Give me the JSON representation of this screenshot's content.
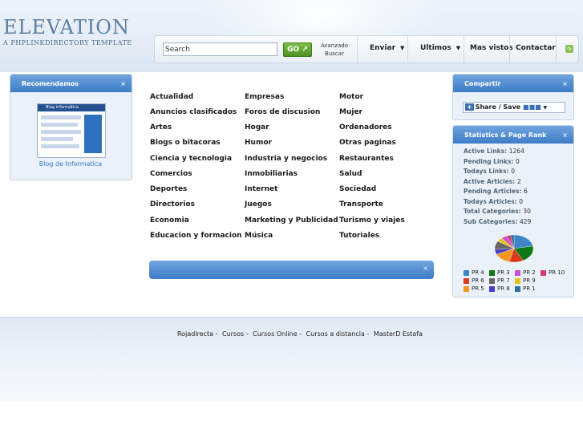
{
  "header": {
    "logo_text": "ELEVATION",
    "tagline": "A PHPLINKDIRECTORY TEMPLATE"
  },
  "search": {
    "value": "Search",
    "go_label": "GO",
    "advanced_line1": "Avanzado",
    "advanced_line2": "Buscar"
  },
  "nav": {
    "enviar": "Enviar",
    "ultimos": "Ultimos",
    "mas_vistos": "Mas vistos",
    "contactar": "Contactar",
    "rss_icon": "rss-icon"
  },
  "recomendamos": {
    "title": "Recomendamos",
    "close": "×",
    "thumb_title": "Blog informática",
    "caption": "Blog de Informatica"
  },
  "categories": {
    "col1": [
      "Actualidad",
      "Anuncios clasificados",
      "Artes",
      "Blogs o bitacoras",
      "Ciencia y tecnologia",
      "Comercios",
      "Deportes",
      "Directorios",
      "Economia",
      "Educacion y formacion"
    ],
    "col2": [
      "Empresas",
      "Foros de discusion",
      "Hogar",
      "Humor",
      "Industria y negocios",
      "Inmobiliarias",
      "Internet",
      "Juegos",
      "Marketing y Publicidad",
      "Música"
    ],
    "col3": [
      "Motor",
      "Mujer",
      "Ordenadores",
      "Otras paginas",
      "Restaurantes",
      "Salud",
      "Sociedad",
      "Transporte",
      "Turismo y viajes",
      "Tutoriales"
    ]
  },
  "center_bar": {
    "close": "×"
  },
  "compartir": {
    "title": "Compartir",
    "close": "×",
    "share_label": "Share / Save"
  },
  "stats": {
    "title": "Statistics & Page Rank",
    "close": "×",
    "rows": [
      {
        "label": "Active Links:",
        "value": "1264"
      },
      {
        "label": "Pending Links:",
        "value": "0"
      },
      {
        "label": "Todays Links:",
        "value": "0"
      },
      {
        "label": "Active Articles:",
        "value": "2"
      },
      {
        "label": "Pending Articles:",
        "value": "6"
      },
      {
        "label": "Todays Articles:",
        "value": "0"
      },
      {
        "label": "Total Categories:",
        "value": "30"
      },
      {
        "label": "Sub Categories:",
        "value": "429"
      }
    ],
    "pagerank_legend": [
      {
        "label": "PR 4",
        "color": "#3d85c6"
      },
      {
        "label": "PR 3",
        "color": "#0b7a14"
      },
      {
        "label": "PR 2",
        "color": "#c94fd0"
      },
      {
        "label": "PR 10",
        "color": "#d63a6a"
      },
      {
        "label": "PR 6",
        "color": "#d93b1c"
      },
      {
        "label": "PR 7",
        "color": "#666666"
      },
      {
        "label": "PR 9",
        "color": "#e0c21a"
      },
      {
        "label": "PR 5",
        "color": "#f2961e"
      },
      {
        "label": "PR 8",
        "color": "#4a3fc4"
      },
      {
        "label": "PR 1",
        "color": "#2e6fa8"
      }
    ],
    "pie_slices": [
      {
        "label": "PR 4",
        "value": 22,
        "color": "#3d85c6"
      },
      {
        "label": "PR 3",
        "value": 20,
        "color": "#0b7a14"
      },
      {
        "label": "PR 6",
        "value": 12,
        "color": "#d93b1c"
      },
      {
        "label": "PR 5",
        "value": 14,
        "color": "#f2961e"
      },
      {
        "label": "PR 8",
        "value": 6,
        "color": "#4a3fc4"
      },
      {
        "label": "PR 7",
        "value": 10,
        "color": "#666666"
      },
      {
        "label": "PR 9",
        "value": 5,
        "color": "#e0c21a"
      },
      {
        "label": "PR 2",
        "value": 5,
        "color": "#c94fd0"
      },
      {
        "label": "PR 10",
        "value": 3,
        "color": "#d63a6a"
      },
      {
        "label": "PR 1",
        "value": 3,
        "color": "#2e6fa8"
      }
    ]
  },
  "footer": {
    "links": [
      "Rojadirecta -",
      "Cursos -",
      "Cursos Online -",
      "Cursos a distancia -",
      "MasterD Estafa"
    ]
  }
}
